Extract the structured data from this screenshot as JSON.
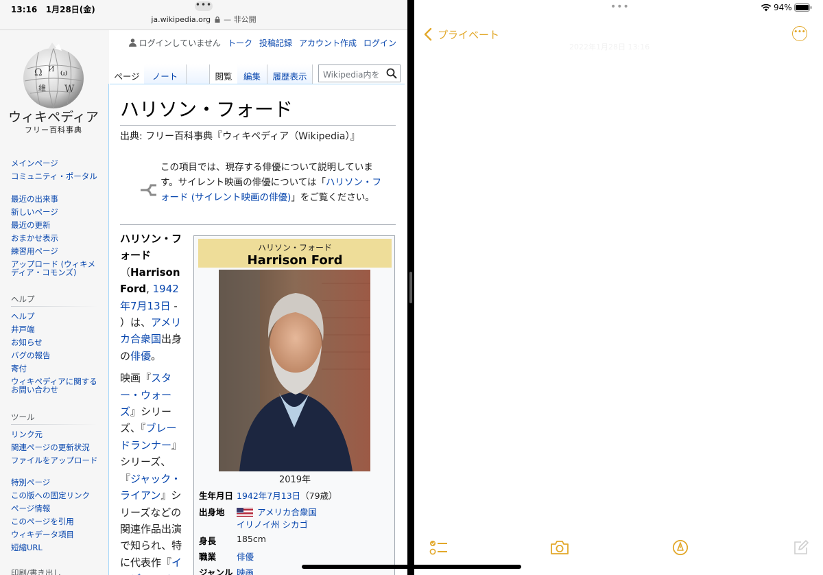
{
  "status": {
    "time": "13:16",
    "date": "1月28日(金)",
    "battery": "94%"
  },
  "safari": {
    "domain": "ja.wikipedia.org",
    "privacy": "— 非公開"
  },
  "wiki": {
    "wordmark": "ウィキペディア",
    "tagline": "フリー百科事典",
    "personal": {
      "not_logged_in": "ログインしていません",
      "talk": "トーク",
      "contributions": "投稿記録",
      "create_account": "アカウント作成",
      "login": "ログイン"
    },
    "tabs": {
      "page": "ページ",
      "note": "ノート",
      "read": "閲覧",
      "edit": "編集",
      "history": "履歴表示"
    },
    "search_placeholder": "Wikipedia内を",
    "sidebar": {
      "nav": [
        "メインページ",
        "コミュニティ・ポータル",
        "最近の出来事",
        "新しいページ",
        "最近の更新",
        "おまかせ表示",
        "練習用ページ",
        "アップロード (ウィキメディア・コモンズ)"
      ],
      "help_heading": "ヘルプ",
      "help": [
        "ヘルプ",
        "井戸端",
        "お知らせ",
        "バグの報告",
        "寄付",
        "ウィキペディアに関するお問い合わせ"
      ],
      "tools_heading": "ツール",
      "tools": [
        "リンク元",
        "関連ページの更新状況",
        "ファイルをアップロード",
        "特別ページ",
        "この版への固定リンク",
        "ページ情報",
        "このページを引用",
        "ウィキデータ項目",
        "短縮URL"
      ],
      "print_heading": "印刷/書き出し"
    },
    "title": "ハリソン・フォード",
    "source": "出典: フリー百科事典『ウィキペディア（Wikipedia）』",
    "hatnote": {
      "before": "この項目では、現存する俳優について説明しています。サイレント映画の俳優については「",
      "link": "ハリソン・フォード (サイレント映画の俳優)",
      "after": "」をご覧ください。"
    },
    "lead": {
      "name_ja": "ハリソン・フォード",
      "paren_open": "（",
      "name_en": "Harrison Ford",
      "comma": ", ",
      "birth_link": "1942年7月13日",
      "dash": " - ",
      "paren_close": "）は、",
      "country_link": "アメリカ合衆国",
      "from": "出身の",
      "actor_link": "俳優",
      "end": "。"
    },
    "lead2": {
      "t1": "映画『",
      "sw": "スター・ウォーズ",
      "t2": "』シリーズ、『",
      "br": "ブレードランナー",
      "t3": "』シリーズ、『",
      "jr": "ジャック・ライアン",
      "t4": "』シリーズなどの関連作品出演で知られ、特に代表作『",
      "ij": "インディ・ジョ"
    },
    "infobox": {
      "kana": "ハリソン・フォード",
      "name": "Harrison Ford",
      "caption": "2019年",
      "birth_label": "生年月日",
      "birth_value": "1942年7月13日",
      "age": "（79歳）",
      "origin_label": "出身地",
      "origin_country": "アメリカ合衆国",
      "origin_city": "イリノイ州 シカゴ",
      "height_label": "身長",
      "height_value": "185cm",
      "job_label": "職業",
      "job_value": "俳優",
      "genre_label": "ジャンル",
      "genre_value": "映画"
    }
  },
  "notes": {
    "back_label": "プライベート",
    "date": "2022年1月28日 13:16"
  },
  "colors": {
    "notes_accent": "#e2a82a",
    "wiki_link": "#0645ad",
    "infobox_header": "#eedd99"
  }
}
